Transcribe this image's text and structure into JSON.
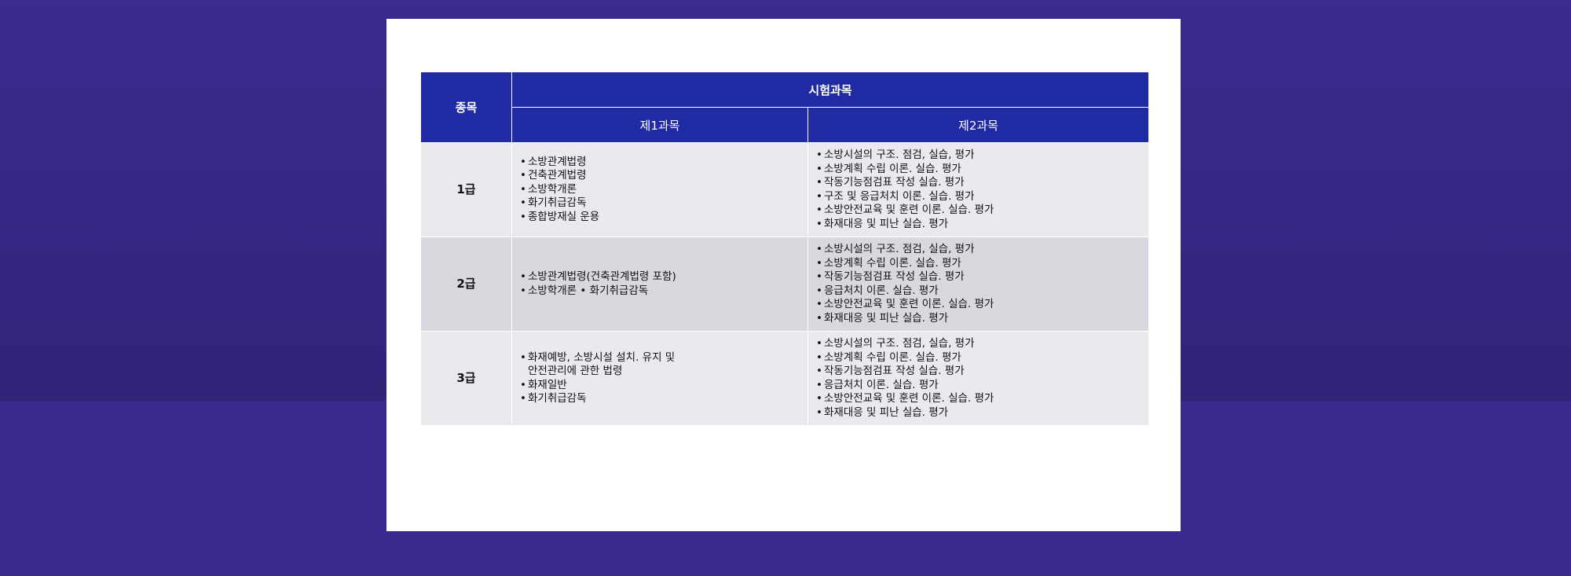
{
  "table": {
    "header_category": "종목",
    "header_exam": "시험과목",
    "header_subject1": "제1과목",
    "header_subject2": "제2과목",
    "bullet": "•",
    "rows": [
      {
        "grade": "1급",
        "subject1": [
          "소방관계법령",
          "건축관계법령",
          "소방학개론",
          "화기취급감독",
          "종합방재실 운용"
        ],
        "subject2": [
          "소방시설의 구조. 점검, 실습, 평가",
          "소방계획 수립 이론. 실습. 평가",
          "작동기능점검표 작성 실습. 평가",
          "구조 및 응급처치 이론. 실습. 평가",
          "소방안전교육 및 훈련 이론. 실습. 평가",
          "화재대응 및 피난 실습. 평가"
        ]
      },
      {
        "grade": "2급",
        "subject1": [
          "소방관계법령(건축관계법령 포함)",
          "소방학개론 • 화기취급감독"
        ],
        "subject2": [
          "소방시설의 구조. 점검, 실습, 평가",
          "소방계획 수립 이론. 실습. 평가",
          "작동기능점검표 작성 실습. 평가",
          "응급처치 이론. 실습. 평가",
          "소방안전교육 및 훈련 이론. 실습. 평가",
          "화재대응 및 피난 실습. 평가"
        ]
      },
      {
        "grade": "3급",
        "subject1": [
          "화재예방, 소방시설 설치. 유지 및",
          "안전관리에 관한 법령",
          "화재일반",
          "화기취급감독"
        ],
        "subject2": [
          "소방시설의 구조. 점검, 실습, 평가",
          "소방계획 수립 이론. 실습. 평가",
          "작동기능점검표 작성 실습. 평가",
          "응급처치 이론. 실습. 평가",
          "소방안전교육 및 훈련 이론. 실습. 평가",
          "화재대응 및 피난 실습. 평가"
        ]
      }
    ]
  }
}
